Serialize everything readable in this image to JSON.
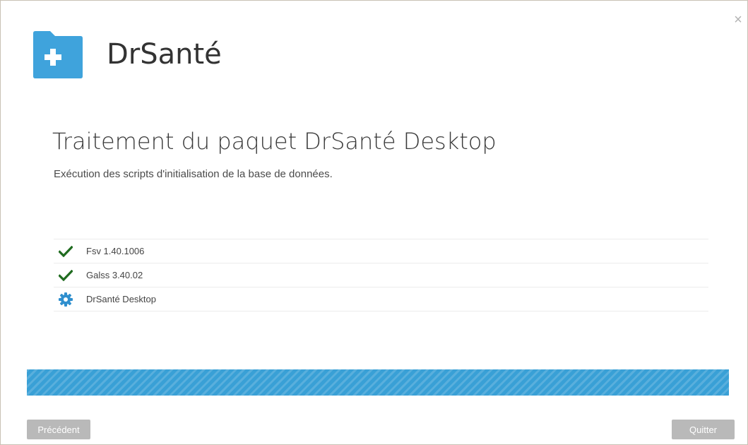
{
  "app": {
    "brand_name": "DrSanté",
    "close_symbol": "×"
  },
  "header": {
    "title": "Traitement du paquet DrSanté Desktop",
    "subtitle": "Exécution des scripts d'initialisation de la base de données."
  },
  "packages": [
    {
      "label": "Fsv 1.40.1006",
      "status": "done",
      "icon": "check-icon"
    },
    {
      "label": "Galss 3.40.02",
      "status": "done",
      "icon": "check-icon"
    },
    {
      "label": "DrSanté Desktop",
      "status": "in-progress",
      "icon": "gear-icon"
    }
  ],
  "progress": {
    "value": 100,
    "state": "indeterminate"
  },
  "buttons": {
    "previous_label": "Précédent",
    "quit_label": "Quitter"
  },
  "colors": {
    "accent": "#39a0d6",
    "check": "#1f6b1f",
    "gear": "#2f8fce",
    "button_disabled": "#b9b9b9"
  }
}
